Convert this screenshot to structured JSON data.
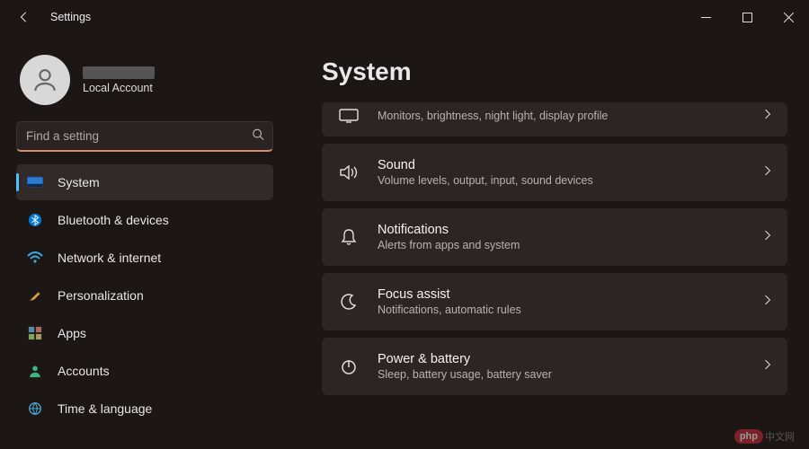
{
  "window": {
    "title": "Settings"
  },
  "user": {
    "account_type": "Local Account"
  },
  "search": {
    "placeholder": "Find a setting"
  },
  "sidebar": {
    "items": [
      {
        "label": "System"
      },
      {
        "label": "Bluetooth & devices"
      },
      {
        "label": "Network & internet"
      },
      {
        "label": "Personalization"
      },
      {
        "label": "Apps"
      },
      {
        "label": "Accounts"
      },
      {
        "label": "Time & language"
      }
    ]
  },
  "main": {
    "heading": "System",
    "cards": [
      {
        "title": "",
        "subtitle": "Monitors, brightness, night light, display profile"
      },
      {
        "title": "Sound",
        "subtitle": "Volume levels, output, input, sound devices"
      },
      {
        "title": "Notifications",
        "subtitle": "Alerts from apps and system"
      },
      {
        "title": "Focus assist",
        "subtitle": "Notifications, automatic rules"
      },
      {
        "title": "Power & battery",
        "subtitle": "Sleep, battery usage, battery saver"
      }
    ]
  },
  "watermark": {
    "badge": "php",
    "text": "中文网"
  }
}
